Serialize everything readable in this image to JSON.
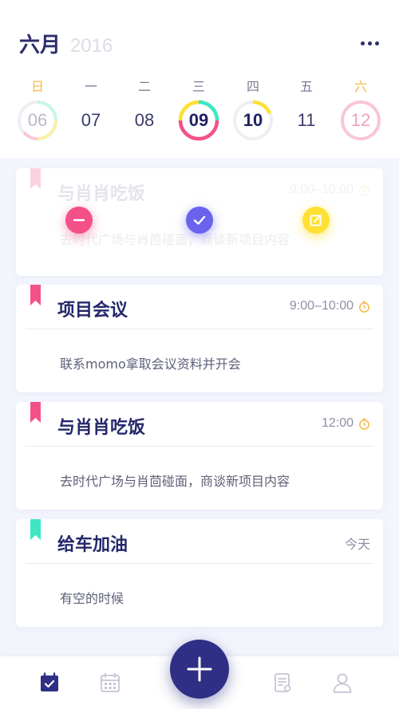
{
  "header": {
    "month": "六月",
    "year": "2016"
  },
  "week": [
    {
      "weekday": "日",
      "date": "06",
      "weekend": true
    },
    {
      "weekday": "一",
      "date": "07",
      "weekend": false
    },
    {
      "weekday": "二",
      "date": "08",
      "weekend": false
    },
    {
      "weekday": "三",
      "date": "09",
      "weekend": false
    },
    {
      "weekday": "四",
      "date": "10",
      "weekend": false
    },
    {
      "weekday": "五",
      "date": "11",
      "weekend": false
    },
    {
      "weekday": "六",
      "date": "12",
      "weekend": true
    }
  ],
  "cards": [
    {
      "title": "与肖肖吃饭",
      "time": "9:00–10:00",
      "desc": "去时代广场与肖茴碰面，商谈新项目内容",
      "ribbon": "#f3508a",
      "state": "swiped"
    },
    {
      "title": "项目会议",
      "time": "9:00–10:00",
      "desc": "联系momo拿取会议资料并开会",
      "ribbon": "#f3508a"
    },
    {
      "title": "与肖肖吃饭",
      "time": "12:00",
      "desc": "去时代广场与肖茴碰面，商谈新项目内容",
      "ribbon": "#f3508a"
    },
    {
      "title": "给车加油",
      "time": "今天",
      "desc": "有空的时候",
      "ribbon": "#3ee6c4"
    }
  ],
  "actions": {
    "delete_icon": "minus-icon",
    "done_icon": "check-icon",
    "edit_icon": "edit-icon"
  },
  "colors": {
    "accent": "#2f2f85",
    "pink": "#f3508a",
    "teal": "#3ee6c4",
    "yellow": "#ffe033",
    "purple": "#6a63ee",
    "weekend": "#f5b84a"
  },
  "nav": {
    "items": [
      "todo-icon",
      "calendar-icon",
      "add-icon",
      "notes-icon",
      "profile-icon"
    ]
  }
}
